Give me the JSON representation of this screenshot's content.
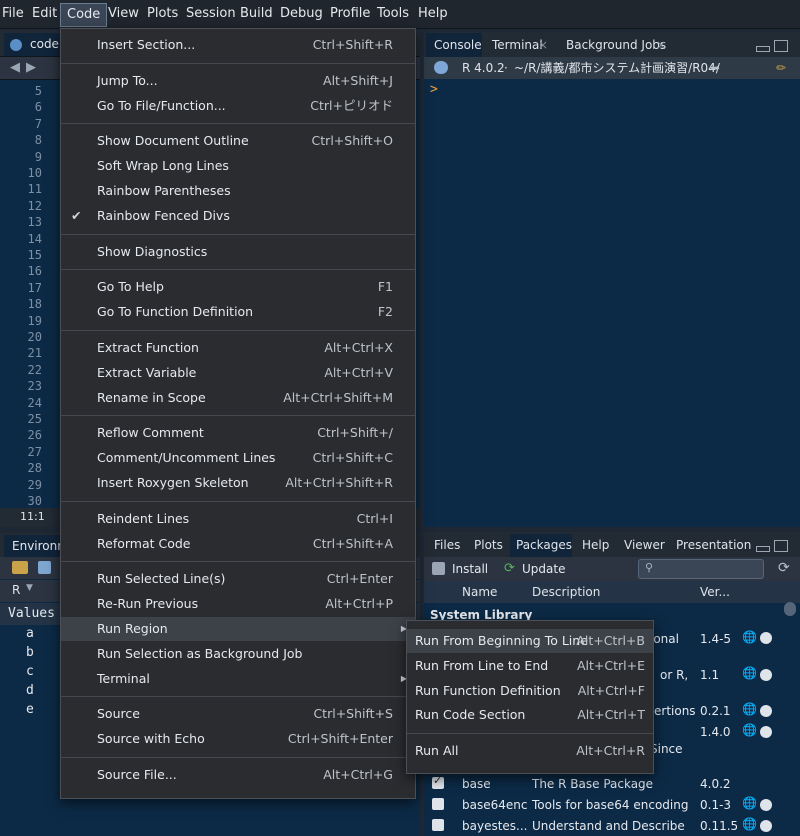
{
  "menubar": {
    "items": [
      "File",
      "Edit",
      "Code",
      "View",
      "Plots",
      "Session",
      "Build",
      "Debug",
      "Profile",
      "Tools",
      "Help"
    ],
    "active": "Code"
  },
  "editor": {
    "tab_label": "code.",
    "line_numbers": [
      "5",
      "6",
      "7",
      "8",
      "9",
      "10",
      "11",
      "12",
      "13",
      "14",
      "15",
      "16",
      "17",
      "18",
      "19",
      "20",
      "21",
      "22",
      "23",
      "24",
      "25",
      "26",
      "27",
      "28",
      "29",
      "30"
    ],
    "cursor_pos": "11:1"
  },
  "environment": {
    "tab_label": "Environm",
    "lang": "R",
    "values_header": "Values",
    "rows": [
      "a",
      "b",
      "c",
      "d",
      "e"
    ]
  },
  "console": {
    "tabs": [
      "Console",
      "Terminal",
      "Background Jobs"
    ],
    "r_version": "R 4.0.2",
    "path": "~/R/講義/都市システム計画演習/R04/",
    "prompt": ">"
  },
  "files": {
    "tabs": [
      "Files",
      "Plots",
      "Packages",
      "Help",
      "Viewer",
      "Presentation"
    ],
    "active_tab": "Packages",
    "install_label": "Install",
    "update_label": "Update",
    "columns": [
      "Name",
      "Description",
      "Ver..."
    ],
    "section": "System Library",
    "partial_rows": [
      {
        "desc": "ional",
        "ver": "1.4-5"
      },
      {
        "desc": "or R,",
        "ver": "1.1"
      },
      {
        "desc": "ertions",
        "ver": "0.2.1"
      },
      {
        "desc": "Since",
        "ver": "1.4.0"
      }
    ],
    "rows": [
      {
        "name": "base",
        "desc": "The R Base Package",
        "ver": "4.0.2",
        "checked": true
      },
      {
        "name": "base64enc",
        "desc": "Tools for base64 encoding",
        "ver": "0.1-3",
        "checked": false
      },
      {
        "name": "bayestes...",
        "desc": "Understand and Describe",
        "ver": "0.11.5",
        "checked": false
      }
    ]
  },
  "code_menu": {
    "items": [
      {
        "label": "Insert Section...",
        "shortcut": "Ctrl+Shift+R"
      },
      {
        "label": "Jump To...",
        "shortcut": "Alt+Shift+J"
      },
      {
        "label": "Go To File/Function...",
        "shortcut": "Ctrl+ピリオド"
      },
      {
        "label": "Show Document Outline",
        "shortcut": "Ctrl+Shift+O"
      },
      {
        "label": "Soft Wrap Long Lines",
        "shortcut": ""
      },
      {
        "label": "Rainbow Parentheses",
        "shortcut": ""
      },
      {
        "label": "Rainbow Fenced Divs",
        "shortcut": "",
        "checked": true
      },
      {
        "label": "Show Diagnostics",
        "shortcut": ""
      },
      {
        "label": "Go To Help",
        "shortcut": "F1"
      },
      {
        "label": "Go To Function Definition",
        "shortcut": "F2"
      },
      {
        "label": "Extract Function",
        "shortcut": "Alt+Ctrl+X"
      },
      {
        "label": "Extract Variable",
        "shortcut": "Alt+Ctrl+V"
      },
      {
        "label": "Rename in Scope",
        "shortcut": "Alt+Ctrl+Shift+M"
      },
      {
        "label": "Reflow Comment",
        "shortcut": "Ctrl+Shift+/"
      },
      {
        "label": "Comment/Uncomment Lines",
        "shortcut": "Ctrl+Shift+C"
      },
      {
        "label": "Insert Roxygen Skeleton",
        "shortcut": "Alt+Ctrl+Shift+R"
      },
      {
        "label": "Reindent Lines",
        "shortcut": "Ctrl+I"
      },
      {
        "label": "Reformat Code",
        "shortcut": "Ctrl+Shift+A"
      },
      {
        "label": "Run Selected Line(s)",
        "shortcut": "Ctrl+Enter"
      },
      {
        "label": "Re-Run Previous",
        "shortcut": "Alt+Ctrl+P"
      },
      {
        "label": "Run Region",
        "shortcut": "",
        "submenu": true
      },
      {
        "label": "Run Selection as Background Job",
        "shortcut": ""
      },
      {
        "label": "Terminal",
        "shortcut": "",
        "submenu": true
      },
      {
        "label": "Source",
        "shortcut": "Ctrl+Shift+S"
      },
      {
        "label": "Source with Echo",
        "shortcut": "Ctrl+Shift+Enter"
      },
      {
        "label": "Source File...",
        "shortcut": "Alt+Ctrl+G"
      }
    ]
  },
  "run_region_submenu": {
    "items": [
      {
        "label": "Run From Beginning To Line",
        "shortcut": "Alt+Ctrl+B"
      },
      {
        "label": "Run From Line to End",
        "shortcut": "Alt+Ctrl+E"
      },
      {
        "label": "Run Function Definition",
        "shortcut": "Alt+Ctrl+F"
      },
      {
        "label": "Run Code Section",
        "shortcut": "Alt+Ctrl+T"
      },
      {
        "label": "Run All",
        "shortcut": "Alt+Ctrl+R"
      }
    ]
  }
}
